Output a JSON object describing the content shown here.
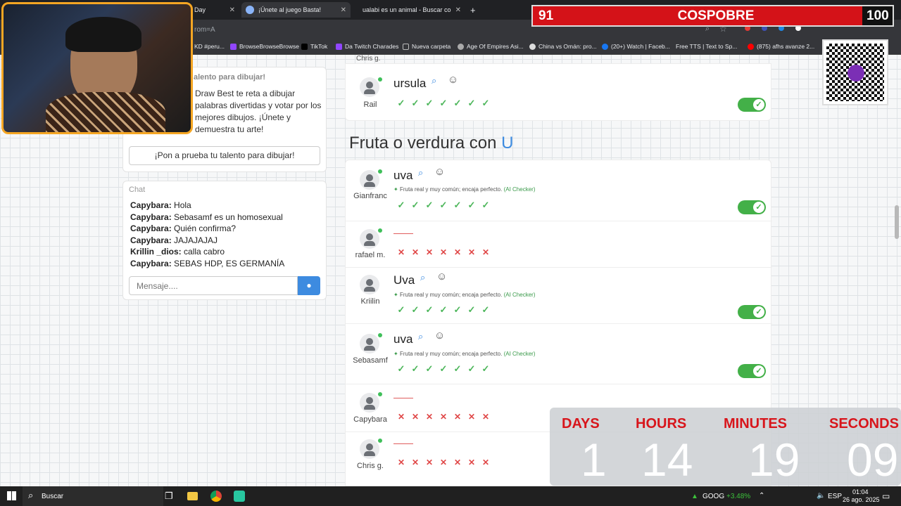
{
  "browser": {
    "tabs": [
      {
        "label": "Day"
      },
      {
        "label": "¡Únete al juego Basta!"
      },
      {
        "label": "ualabi es un animal - Buscar co"
      }
    ],
    "new_tab": "+",
    "url_fragment": "rom=A",
    "bookmarks": [
      "KD #peru...",
      "BrowseBrowseBrowse",
      "TikTok",
      "Da Twitch Charades",
      "Nueva carpeta",
      "Age Of Empires Asi...",
      "China vs Omán: pro...",
      "(20+) Watch | Faceb...",
      "Free TTS | Text to Sp...",
      "(875) afhs avanze 2..."
    ]
  },
  "stream_overlay": {
    "score_left": "91",
    "title": "COSPOBRE",
    "score_right": "100",
    "countdown": {
      "labels": [
        "DAYS",
        "HOURS",
        "MINUTES",
        "SECONDS"
      ],
      "values": [
        "1",
        "14",
        "19",
        "09"
      ]
    }
  },
  "promo": {
    "title": "alento para dibujar!",
    "body": "Draw Best te reta a dibujar palabras divertidas y votar por los mejores dibujos. ¡Únete y demuestra tu arte!",
    "button": "¡Pon a prueba tu talento para dibujar!"
  },
  "chat": {
    "title": "Chat",
    "messages": [
      {
        "user": "Capybara:",
        "text": "Hola"
      },
      {
        "user": "Capybara:",
        "text": "Sebasamf es un homosexual"
      },
      {
        "user": "Capybara:",
        "text": "Quién confirma?"
      },
      {
        "user": "Capybara:",
        "text": "JAJAJAJAJ"
      },
      {
        "user": "Krillin _dios:",
        "text": "calla cabro"
      },
      {
        "user": "Capybara:",
        "text": "SEBAS HDP, ES GERMANÍA"
      }
    ],
    "input_placeholder": "Mensaje...."
  },
  "feed": {
    "top_partial_name": "Chris g.",
    "first_entry": {
      "player": "Rail",
      "word": "ursula"
    },
    "category_prefix": "Fruta o verdura con",
    "category_letter": "U",
    "ai_note": "Fruta real y muy común; encaja perfecto.",
    "ai_tag": "(AI Checker)",
    "entries": [
      {
        "player": "Gianfranc",
        "word": "uva"
      },
      {
        "player": "rafael m.",
        "word": ""
      },
      {
        "player": "Kriilin",
        "word": "Uva"
      },
      {
        "player": "Sebasamf",
        "word": "uva"
      },
      {
        "player": "Capybara",
        "word": ""
      },
      {
        "player": "Chris g.",
        "word": ""
      }
    ]
  },
  "taskbar": {
    "search": "Buscar",
    "ticker": "GOOG",
    "ticker_change": "+3.48%",
    "lang": "ESP",
    "time": "01:04",
    "date": "26 ago. 2025"
  }
}
